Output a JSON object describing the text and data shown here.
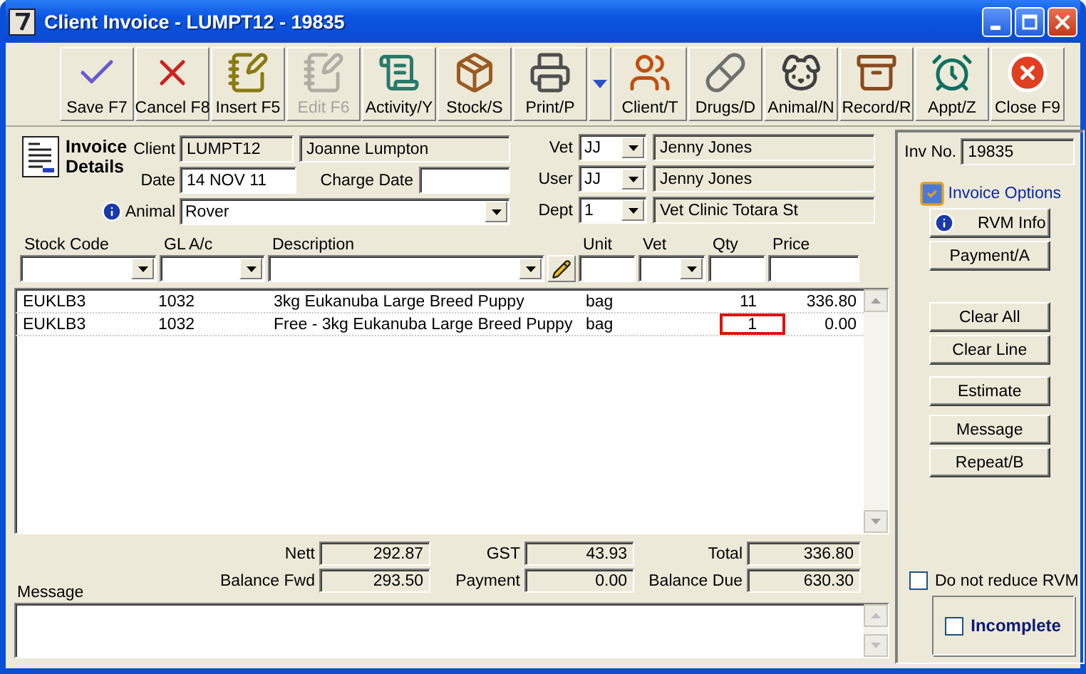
{
  "window": {
    "title": "Client Invoice - LUMPT12 - 19835"
  },
  "toolbar": [
    {
      "kind": "save",
      "label": "Save F7",
      "disabled": false,
      "has_menu": false
    },
    {
      "kind": "cancel",
      "label": "Cancel F8",
      "disabled": false,
      "has_menu": false
    },
    {
      "kind": "insert",
      "label": "Insert F5",
      "disabled": false,
      "has_menu": false
    },
    {
      "kind": "edit",
      "label": "Edit F6",
      "disabled": true,
      "has_menu": false
    },
    {
      "kind": "activity",
      "label": "Activity/Y",
      "disabled": false,
      "has_menu": false
    },
    {
      "kind": "stock",
      "label": "Stock/S",
      "disabled": false,
      "has_menu": false
    },
    {
      "kind": "print",
      "label": "Print/P",
      "disabled": false,
      "has_menu": true
    },
    {
      "kind": "client",
      "label": "Client/T",
      "disabled": false,
      "has_menu": false
    },
    {
      "kind": "drugs",
      "label": "Drugs/D",
      "disabled": false,
      "has_menu": false
    },
    {
      "kind": "animal",
      "label": "Animal/N",
      "disabled": false,
      "has_menu": false
    },
    {
      "kind": "record",
      "label": "Record/R",
      "disabled": false,
      "has_menu": false
    },
    {
      "kind": "appt",
      "label": "Appt/Z",
      "disabled": false,
      "has_menu": false
    },
    {
      "kind": "close",
      "label": "Close F9",
      "disabled": false,
      "has_menu": false
    }
  ],
  "header": {
    "title": "Invoice Details",
    "client": {
      "label": "Client",
      "code": "LUMPT12",
      "name": "Joanne Lumpton"
    },
    "date": {
      "label": "Date",
      "value": "14 NOV 11"
    },
    "charge_date": {
      "label": "Charge Date"
    },
    "animal": {
      "label": "Animal",
      "value": "Rover"
    },
    "staff": [
      {
        "label": "Vet",
        "code": "JJ",
        "name": "Jenny Jones"
      },
      {
        "label": "User",
        "code": "JJ",
        "name": "Jenny Jones"
      },
      {
        "label": "Dept",
        "code": "1",
        "name": "Vet Clinic Totara St"
      }
    ]
  },
  "entry_columns": [
    {
      "label": "Stock Code",
      "kind": "combo"
    },
    {
      "label": "GL A/c",
      "kind": "combo"
    },
    {
      "label": "Description",
      "kind": "combo"
    },
    {
      "kind": "pencil"
    },
    {
      "label": "Unit",
      "kind": "text"
    },
    {
      "label": "Vet",
      "kind": "combo"
    },
    {
      "label": "Qty",
      "kind": "text"
    },
    {
      "label": "Price",
      "kind": "text"
    }
  ],
  "lines": [
    {
      "stock_code": "EUKLB3",
      "gl": "1032",
      "description": "3kg Eukanuba Large Breed Puppy",
      "unit": "bag",
      "qty": "11",
      "price": "336.80",
      "qty_flagged": false
    },
    {
      "stock_code": "EUKLB3",
      "gl": "1032",
      "description": "Free - 3kg Eukanuba Large Breed Puppy",
      "unit": "bag",
      "qty": "1",
      "price": "0.00",
      "qty_flagged": true
    }
  ],
  "totals": [
    {
      "label": "Nett",
      "value": "292.87"
    },
    {
      "label": "GST",
      "value": "43.93"
    },
    {
      "label": "Total",
      "value": "336.80"
    },
    {
      "label": "Balance Fwd",
      "value": "293.50"
    },
    {
      "label": "Payment",
      "value": "0.00"
    },
    {
      "label": "Balance Due",
      "value": "630.30"
    }
  ],
  "message": {
    "label": "Message"
  },
  "side": {
    "inv_no": {
      "label": "Inv No.",
      "value": "19835"
    },
    "options_link": "Invoice Options",
    "button_groups": [
      [
        {
          "label": "RVM Info",
          "kind": "info"
        },
        {
          "label": "Payment/A",
          "kind": "plain"
        }
      ],
      [
        {
          "label": "Clear All",
          "kind": "plain"
        },
        {
          "label": "Clear Line",
          "kind": "plain"
        }
      ],
      [
        {
          "label": "Estimate",
          "kind": "plain"
        }
      ],
      [
        {
          "label": "Message",
          "kind": "plain"
        },
        {
          "label": "Repeat/B",
          "kind": "plain"
        }
      ]
    ],
    "reduce_rvm": {
      "label": "Do not reduce RVM",
      "checked": false
    },
    "incomplete": {
      "label": "Incomplete",
      "checked": false
    }
  }
}
